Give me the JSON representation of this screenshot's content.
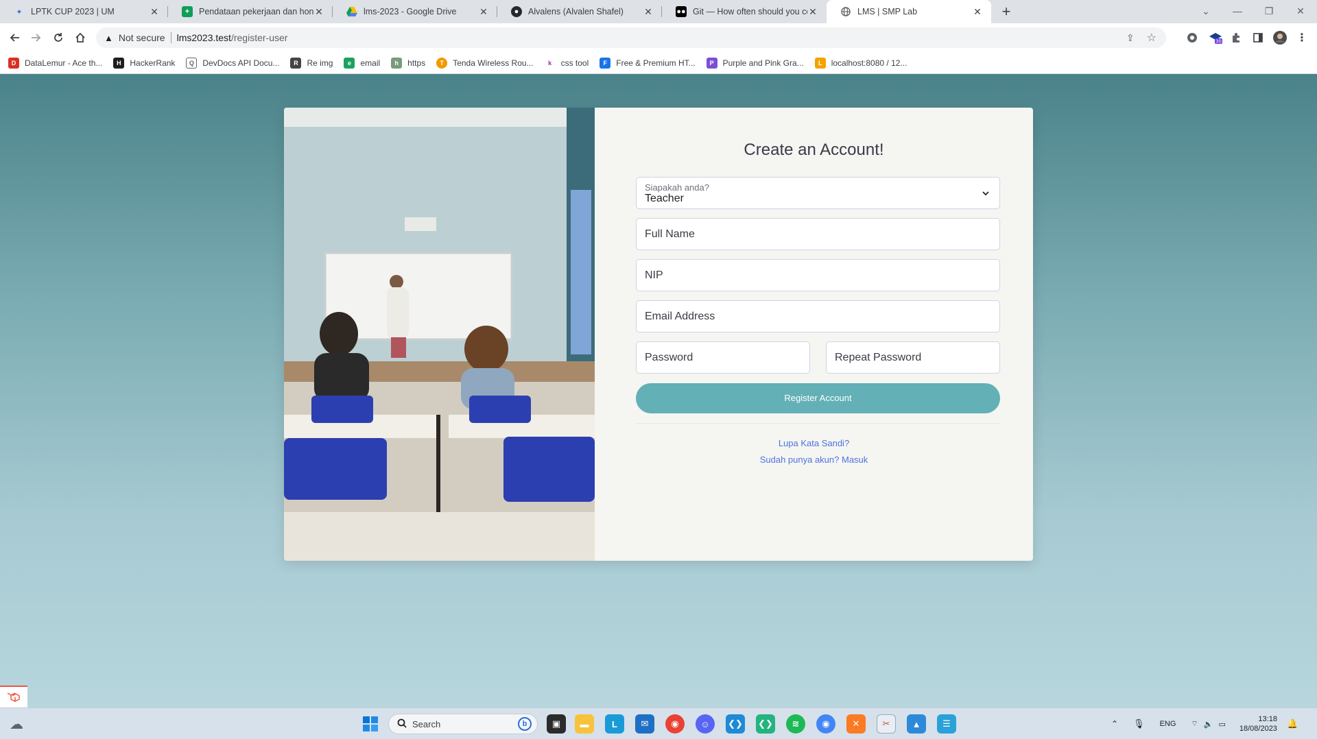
{
  "browser": {
    "tabs": [
      {
        "title": "LPTK CUP 2023 | UM",
        "icon": "lptk-favicon",
        "color": "#2b7bd6"
      },
      {
        "title": "Pendataan pekerjaan dan honor",
        "icon": "sheets-favicon",
        "color": "#0f9d58"
      },
      {
        "title": "lms-2023 - Google Drive",
        "icon": "drive-favicon",
        "color": "#fbbc04"
      },
      {
        "title": "Alvalens (Alvalen Shafel)",
        "icon": "github-favicon",
        "color": "#24292f"
      },
      {
        "title": "Git — How often should you con",
        "icon": "medium-favicon",
        "color": "#000000"
      },
      {
        "title": "LMS | SMP Lab",
        "icon": "globe-favicon",
        "color": "#5f6368"
      }
    ],
    "address": {
      "security": "Not secure",
      "host": "lms2023.test",
      "path": "/register-user"
    },
    "bookmarks": [
      {
        "label": "DataLemur - Ace th...",
        "color": "#d93025",
        "glyph": "D"
      },
      {
        "label": "HackerRank",
        "color": "#1f1f1f",
        "glyph": "H"
      },
      {
        "label": "DevDocs API Docu...",
        "color": "#5f6368",
        "glyph": "Q"
      },
      {
        "label": "Re img",
        "color": "#444",
        "glyph": "R"
      },
      {
        "label": "email",
        "color": "#1aa260",
        "glyph": "e"
      },
      {
        "label": "https",
        "color": "#7a9a7a",
        "glyph": "h"
      },
      {
        "label": "Tenda Wireless Rou...",
        "color": "#f29900",
        "glyph": "T"
      },
      {
        "label": "css tool",
        "color": "#9c27b0",
        "glyph": "k"
      },
      {
        "label": "Free & Premium HT...",
        "color": "#1a73e8",
        "glyph": "F"
      },
      {
        "label": "Purple and Pink Gra...",
        "color": "#7b4fd6",
        "glyph": "P"
      },
      {
        "label": "localhost:8080 / 12...",
        "color": "#f4a300",
        "glyph": "L"
      }
    ]
  },
  "form": {
    "title": "Create an Account!",
    "role_label": "Siapakah anda?",
    "role_value": "Teacher",
    "full_name_placeholder": "Full Name",
    "nip_placeholder": "NIP",
    "email_placeholder": "Email Address",
    "password_placeholder": "Password",
    "repeat_password_placeholder": "Repeat Password",
    "register_label": "Register Account",
    "forgot_link": "Lupa Kata Sandi?",
    "login_link": "Sudah punya akun? Masuk",
    "accent_color": "#63b0b6",
    "link_color": "#4e73df"
  },
  "taskbar": {
    "search_placeholder": "Search",
    "language": "ENG",
    "time": "13:18",
    "date": "18/08/2023"
  }
}
